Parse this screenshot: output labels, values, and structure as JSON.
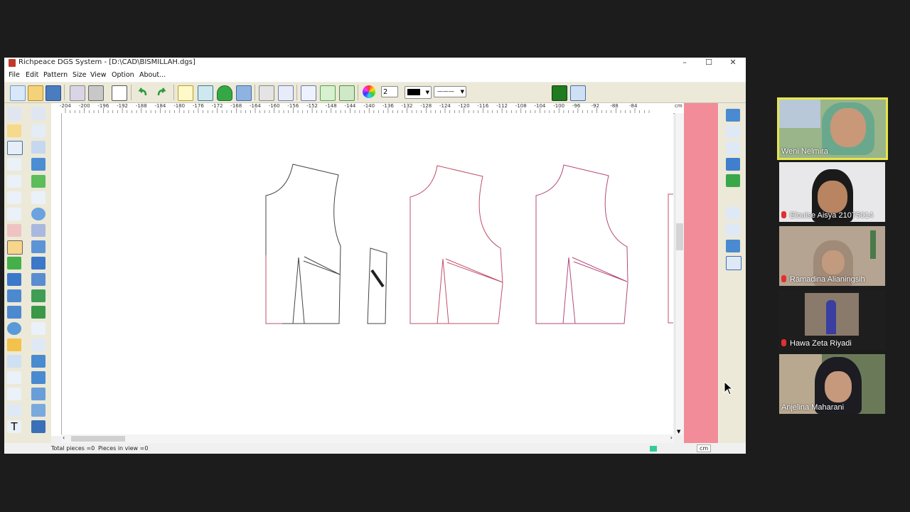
{
  "window": {
    "title": "Richpeace DGS System - [D:\\CAD\\BISMILLAH.dgs]",
    "minimize": "–",
    "maximize": "☐",
    "close": "✕"
  },
  "menu": [
    "File",
    "Edit",
    "Pattern",
    "Size",
    "View",
    "Option",
    "About..."
  ],
  "toolbar": {
    "pen_width": "2",
    "line_style": "———"
  },
  "ruler": {
    "unit": "cm",
    "ticks": [
      "-204",
      "-200",
      "-196",
      "-192",
      "-188",
      "-184",
      "-180",
      "-176",
      "-172",
      "-168",
      "-164",
      "-160",
      "-156",
      "-152",
      "-148",
      "-144",
      "-140",
      "-136",
      "-132",
      "-128",
      "-124",
      "-120",
      "-116",
      "-112",
      "-108",
      "-104",
      "-100",
      "-96",
      "-92",
      "-88",
      "-84"
    ]
  },
  "status": {
    "total_pieces": "Total pieces =0",
    "pieces_in_view": "Pieces in view =0",
    "unit": "cm"
  },
  "participants": [
    {
      "name": "Weni Nelmira",
      "muted": false,
      "active": true
    },
    {
      "name": "Elouise Aisya 21075014",
      "muted": true,
      "active": false
    },
    {
      "name": "Ramadina Alianingsih",
      "muted": true,
      "active": false
    },
    {
      "name": "Hawa Zeta Riyadi",
      "muted": true,
      "active": false
    },
    {
      "name": "Anjelina Maharani",
      "muted": false,
      "active": false
    }
  ],
  "colors": {
    "pattern_black": "#444444",
    "pattern_pink": "#c0506a",
    "side_panel": "#f28c98",
    "active_speaker": "#e6e64a"
  }
}
